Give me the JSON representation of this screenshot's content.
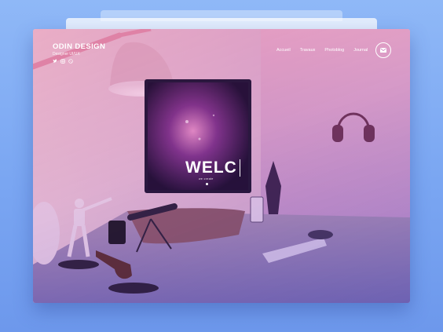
{
  "brand": {
    "title": "ODIN DESIGN",
    "subtitle": "Designer UI/UX"
  },
  "socials": [
    {
      "icon": "twitter-icon"
    },
    {
      "icon": "instagram-icon"
    },
    {
      "icon": "dribbble-icon"
    }
  ],
  "nav": [
    {
      "label": "Accueil"
    },
    {
      "label": "Travaux"
    },
    {
      "label": "Photoblog"
    },
    {
      "label": "Journal"
    }
  ],
  "contact": {
    "icon": "mail-icon"
  },
  "hero": {
    "title": "WELC",
    "subtitle": "we create"
  },
  "colors": {
    "background": "#8fb8f7",
    "tint_pink": "#ec78aa",
    "tint_violet": "#7864d2",
    "text": "#ffffff"
  }
}
